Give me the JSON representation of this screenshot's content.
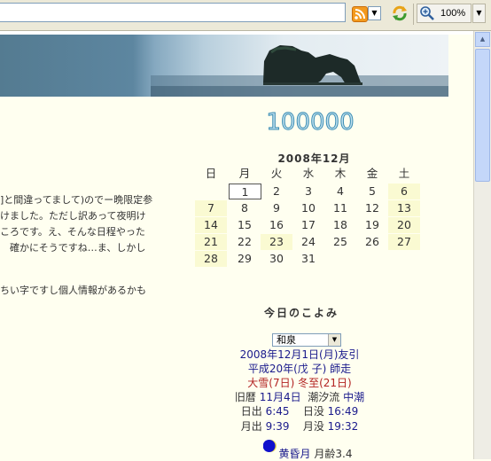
{
  "toolbar": {
    "zoom_level": "100%"
  },
  "counter": "100000",
  "calendar": {
    "title": "2008年12月",
    "weekdays": [
      "日",
      "月",
      "火",
      "水",
      "木",
      "金",
      "土"
    ],
    "weeks": [
      [
        "",
        "1",
        "2",
        "3",
        "4",
        "5",
        "6"
      ],
      [
        "7",
        "8",
        "9",
        "10",
        "11",
        "12",
        "13"
      ],
      [
        "14",
        "15",
        "16",
        "17",
        "18",
        "19",
        "20"
      ],
      [
        "21",
        "22",
        "23",
        "24",
        "25",
        "26",
        "27"
      ],
      [
        "28",
        "29",
        "30",
        "31",
        "",
        "",
        ""
      ]
    ],
    "today": "1",
    "holidays": [
      "6",
      "7",
      "13",
      "14",
      "20",
      "21",
      "23",
      "27",
      "28"
    ]
  },
  "article": {
    "lines": [
      "]と間違ってまして)のでー晩限定参",
      "けました。ただし訳あって夜明け",
      "ころです。え、そんな日程やった",
      "　確かにそうですね…ま、しかし",
      "ちい字ですし個人情報があるかも"
    ]
  },
  "koyomi": {
    "title": "今日のこよみ",
    "location": "和泉",
    "date_prefix": "2008年12月1日(月)",
    "rokuyo": "友引",
    "wareki_year": "平成20年",
    "eto": "(戊 子)",
    "month_name": "師走",
    "sekki1": "大雪(7日)",
    "sekki2": "冬至(21日)",
    "kyureki_label": "旧暦",
    "kyureki": "11月4日",
    "shio_label": "潮汐流",
    "shio": "中潮",
    "sunrise_label": "日出",
    "sunrise": "6:45",
    "sunset_label": "日没",
    "sunset": "16:49",
    "moonrise_label": "月出",
    "moonrise": "9:39",
    "moonset_label": "月没",
    "moonset": "19:32",
    "moon_name": "黄昏月",
    "moon_age_label": "月齢",
    "moon_age": "3.4"
  }
}
